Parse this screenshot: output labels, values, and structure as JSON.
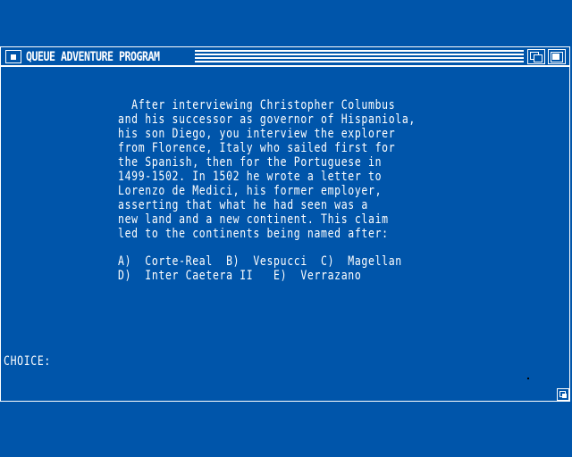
{
  "window": {
    "title": "QUEUE ADVENTURE PROGRAM"
  },
  "content": {
    "passage": "  After interviewing Christopher Columbus\nand his successor as governor of Hispaniola,\nhis son Diego, you interview the explorer\nfrom Florence, Italy who sailed first for\nthe Spanish, then for the Portuguese in\n1499-1502. In 1502 he wrote a letter to\nLorenzo de Medici, his former employer,\nasserting that what he had seen was a\nnew land and a new continent. This claim\nled to the continents being named after:",
    "options": "A)  Corte-Real  B)  Vespucci  C)  Magellan\nD)  Inter Caetera II   E)  Verrazano",
    "prompt": "CHOICE:"
  },
  "icons": {
    "close": "close-gadget-icon",
    "depth": "depth-gadget-icon",
    "zoom": "zoom-gadget-icon",
    "resize": "resize-gadget-icon"
  },
  "colors": {
    "background": "#0055aa",
    "foreground": "#ffffff"
  }
}
